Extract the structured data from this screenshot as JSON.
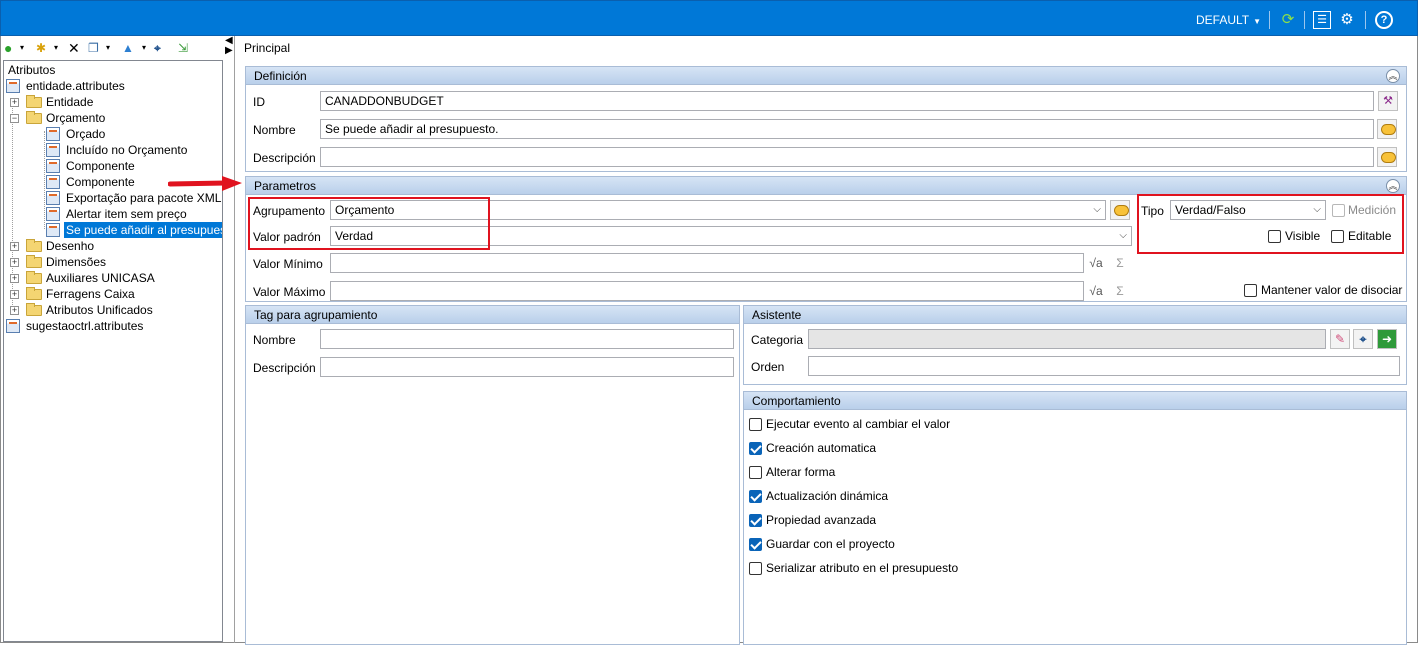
{
  "header": {
    "profile": "DEFAULT",
    "icons": [
      "refresh-icon",
      "layout-icon",
      "settings-icon",
      "help-icon"
    ]
  },
  "toolbar": {
    "icons": [
      "back-icon",
      "new-item-icon",
      "delete-icon",
      "copy-icon",
      "move-up-icon",
      "find-icon",
      "export-icon"
    ]
  },
  "tree": {
    "items": [
      {
        "label": "Atributos"
      },
      {
        "label": "entidade.attributes"
      },
      {
        "label": "Entidade"
      },
      {
        "label": "Orçamento"
      },
      {
        "label": "Orçado"
      },
      {
        "label": "Incluído no Orçamento"
      },
      {
        "label": "Componente"
      },
      {
        "label": "Componente"
      },
      {
        "label": "Exportação para pacote XML"
      },
      {
        "label": "Alertar item sem preço"
      },
      {
        "label": "Se puede añadir al presupuesto"
      },
      {
        "label": "Desenho"
      },
      {
        "label": "Dimensões"
      },
      {
        "label": "Auxiliares UNICASA"
      },
      {
        "label": "Ferragens Caixa"
      },
      {
        "label": "Atributos Unificados"
      },
      {
        "label": "sugestaoctrl.attributes"
      }
    ]
  },
  "main": {
    "tab": "Principal",
    "definicion": {
      "title": "Definición",
      "id_label": "ID",
      "id_value": "CANADDONBUDGET",
      "nombre_label": "Nombre",
      "nombre_value": "Se puede añadir al presupuesto.",
      "descripcion_label": "Descripción",
      "descripcion_value": ""
    },
    "parametros": {
      "title": "Parametros",
      "agrupamento_label": "Agrupamento",
      "agrupamento_value": "Orçamento",
      "valor_padron_label": "Valor padrón",
      "valor_padron_value": "Verdad",
      "valor_minimo_label": "Valor Mínimo",
      "valor_maximo_label": "Valor Máximo",
      "tipo_label": "Tipo",
      "tipo_value": "Verdad/Falso",
      "medicion_label": "Medición",
      "visible_label": "Visible",
      "editable_label": "Editable",
      "mantener_label": "Mantener valor de disociar",
      "sigma": "Σ",
      "sqrt": "√a"
    },
    "tag": {
      "title": "Tag para agrupamiento",
      "nombre_label": "Nombre",
      "descripcion_label": "Descripción"
    },
    "asistente": {
      "title": "Asistente",
      "categoria_label": "Categoria",
      "orden_label": "Orden"
    },
    "comportamiento": {
      "title": "Comportamiento",
      "items": [
        {
          "label": "Ejecutar evento al cambiar el valor",
          "checked": false
        },
        {
          "label": "Creación automatica",
          "checked": true
        },
        {
          "label": "Alterar forma",
          "checked": false
        },
        {
          "label": "Actualización dinámica",
          "checked": true
        },
        {
          "label": "Propiedad avanzada",
          "checked": true
        },
        {
          "label": "Guardar con el proyecto",
          "checked": true
        },
        {
          "label": "Serializar atributo en el presupuesto",
          "checked": false
        }
      ]
    }
  },
  "colors": {
    "accent": "#0078d7",
    "highlight": "#e0131f",
    "panel_header": "#c6d9f0"
  }
}
